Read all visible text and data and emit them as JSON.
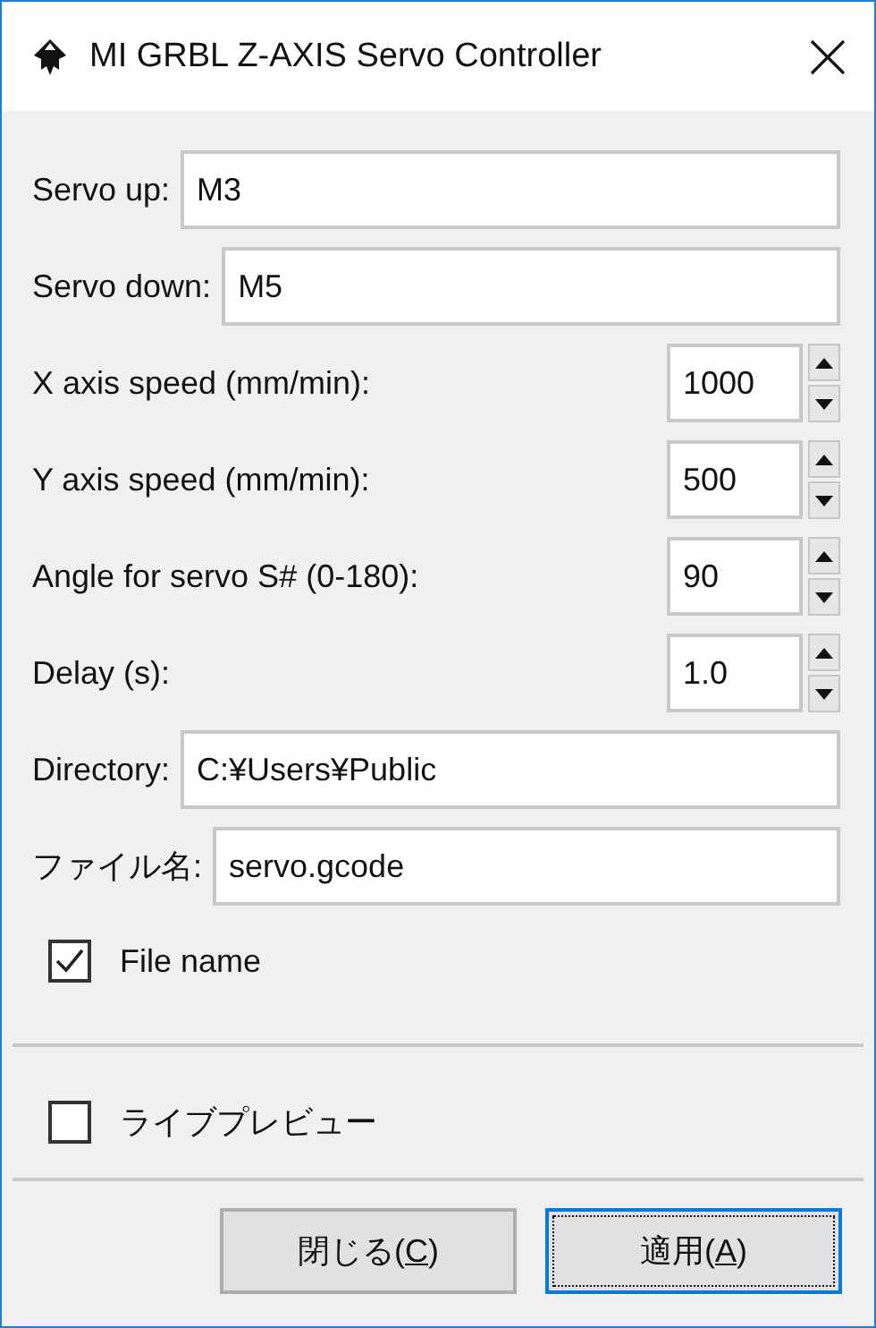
{
  "window": {
    "title": "MI GRBL Z-AXIS Servo Controller"
  },
  "fields": [
    {
      "kind": "text",
      "label": "Servo up:",
      "value": "M3"
    },
    {
      "kind": "text",
      "label": "Servo down:",
      "value": "M5"
    },
    {
      "kind": "spin",
      "label": "X axis speed (mm/min):",
      "value": "1000"
    },
    {
      "kind": "spin",
      "label": "Y axis speed (mm/min):",
      "value": "500"
    },
    {
      "kind": "spin",
      "label": "Angle for servo S# (0-180):",
      "value": "90"
    },
    {
      "kind": "spin",
      "label": "Delay (s):",
      "value": "1.0"
    },
    {
      "kind": "text",
      "label": "Directory:",
      "value": "C:¥Users¥Public"
    },
    {
      "kind": "text",
      "label": "ファイル名:",
      "value": "servo.gcode"
    }
  ],
  "options": [
    {
      "label": "File name",
      "checked": true
    }
  ],
  "live_preview": {
    "label": "ライブプレビュー",
    "checked": false
  },
  "buttons": [
    {
      "text_before": "閉じる(",
      "access_key": "C",
      "text_after": ")",
      "default": false
    },
    {
      "text_before": "適用(",
      "access_key": "A",
      "text_after": ")",
      "default": true
    }
  ]
}
